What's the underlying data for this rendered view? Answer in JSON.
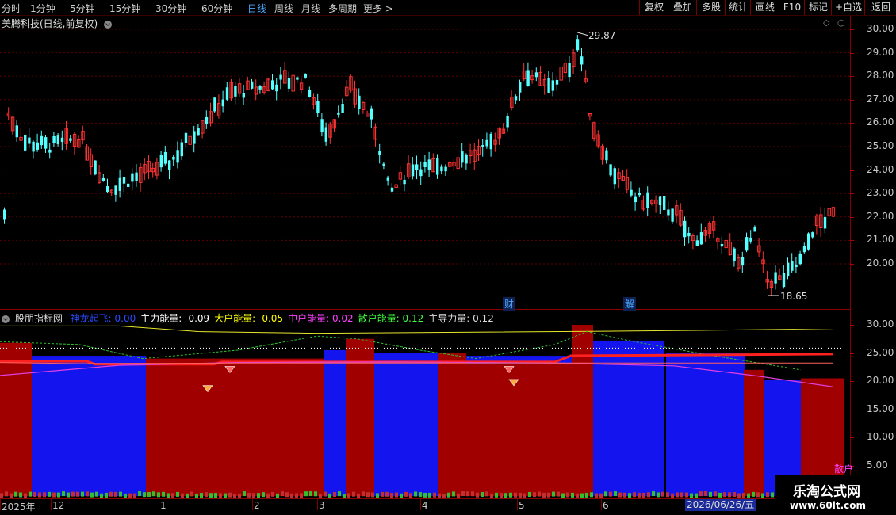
{
  "toolbar": {
    "periods": [
      "分时",
      "1分钟",
      "5分钟",
      "15分钟",
      "30分钟",
      "60分钟",
      "日线",
      "周线",
      "月线",
      "多周期",
      "更多 >"
    ],
    "active_period": "日线",
    "buttons": [
      "复权",
      "叠加",
      "多股",
      "统计",
      "画线",
      "F10",
      "标记",
      "+自选",
      "返回"
    ]
  },
  "main_chart": {
    "title": "美腾科技(日线,前复权)",
    "high_label": "29.87",
    "low_label": "18.65",
    "y_labels": [
      "30.00",
      "29.00",
      "28.00",
      "27.00",
      "26.00",
      "25.00",
      "24.00",
      "23.00",
      "22.00",
      "21.00",
      "20.00"
    ],
    "event_marks": [
      "财",
      "解"
    ]
  },
  "indicator": {
    "name": "股朋指标网",
    "fields": [
      {
        "label": "神龙起飞:",
        "value": "0.00",
        "color": "#2a4bff"
      },
      {
        "label": "主力能量:",
        "value": "-0.09",
        "color": "#ffffff"
      },
      {
        "label": "大户能量:",
        "value": "-0.05",
        "color": "#ffff00"
      },
      {
        "label": "中户能量:",
        "value": "0.02",
        "color": "#ff40ff"
      },
      {
        "label": "散户能量:",
        "value": "0.12",
        "color": "#40ff40"
      },
      {
        "label": "主导力量:",
        "value": "0.12",
        "color": "#dddddd"
      }
    ],
    "y_labels": [
      "30.00",
      "25.00",
      "20.00",
      "15.00",
      "10.00",
      "5.00"
    ],
    "corner_label": "散户"
  },
  "x_axis": {
    "labels": [
      "2025年",
      "12",
      "1",
      "2",
      "3",
      "4",
      "5",
      "6"
    ],
    "cursor_date": "2026/06/26/五"
  },
  "watermark": {
    "title": "乐淘公式网",
    "url": "www.60lt.com"
  },
  "colors": {
    "up": "#ff3232",
    "down": "#54ffff",
    "accent": "#4aa8ff",
    "border": "#8a0000"
  }
}
